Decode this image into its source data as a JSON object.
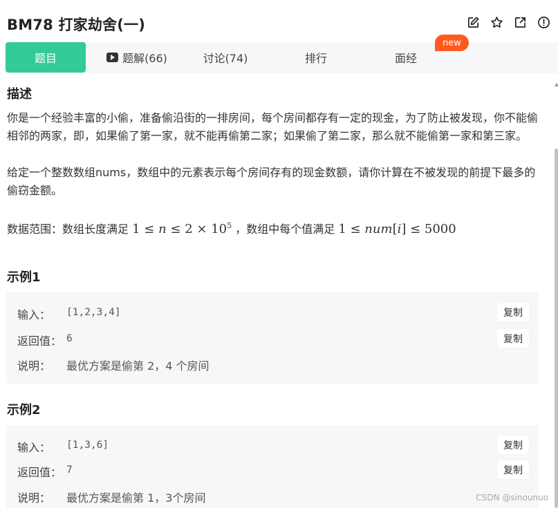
{
  "header": {
    "title": "BM78  打家劫舍(一)",
    "icons": [
      "edit-icon",
      "star-icon",
      "external-link-icon",
      "info-icon"
    ]
  },
  "tabs": [
    {
      "label": "题目",
      "active": true
    },
    {
      "label": "题解(66)",
      "icon": "play-icon"
    },
    {
      "label": "讨论(74)"
    },
    {
      "label": "排行"
    },
    {
      "label": "面经"
    }
  ],
  "badge": {
    "new_label": "new"
  },
  "description": {
    "heading": "描述",
    "p1": "你是一个经验丰富的小偷，准备偷沿街的一排房间，每个房间都存有一定的现金，为了防止被发现，你不能偷相邻的两家，即，如果偷了第一家，就不能再偷第二家；如果偷了第二家，那么就不能偷第一家和第三家。",
    "p2": "给定一个整数数组nums，数组中的元素表示每个房间存有的现金数额，请你计算在不被发现的前提下最多的偷窃金额。",
    "range_prefix": "数据范围：数组长度满足",
    "range_mid": "，数组中每个值满足"
  },
  "examples": [
    {
      "heading": "示例1",
      "input_label": "输入：",
      "input_value": "[1,2,3,4]",
      "output_label": "返回值：",
      "output_value": "6",
      "explain_label": "说明：",
      "explain_value": "最优方案是偷第 2，4 个房间",
      "copy_label": "复制"
    },
    {
      "heading": "示例2",
      "input_label": "输入：",
      "input_value": "[1,3,6]",
      "output_label": "返回值：",
      "output_value": "7",
      "explain_label": "说明：",
      "explain_value": "最优方案是偷第 1，3个房间",
      "copy_label": "复制"
    }
  ],
  "watermark": "CSDN @sinounuo",
  "colors": {
    "accent": "#32ca99",
    "badge": "#ff5a1f",
    "panel": "#f6f7f9"
  }
}
